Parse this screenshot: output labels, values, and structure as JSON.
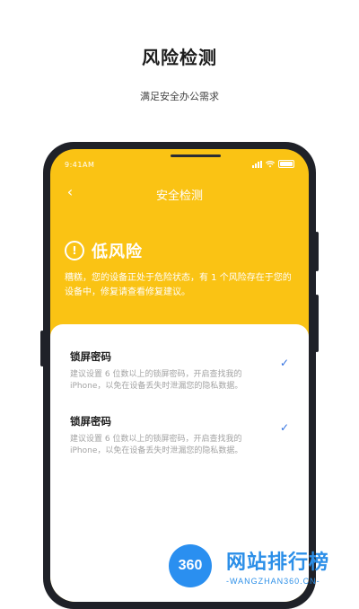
{
  "page": {
    "title": "风险检测",
    "subtitle": "满足安全办公需求"
  },
  "status_bar": {
    "time": "9:41AM"
  },
  "nav": {
    "title": "安全检测"
  },
  "risk": {
    "level": "低风险",
    "description": "糟糕，您的设备正处于危险状态，有 1 个风险存在于您的设备中，修复请查看修复建议。"
  },
  "checks": [
    {
      "title": "锁屏密码",
      "description": "建议设置 6 位数以上的锁屏密码，开启查找我的 iPhone，以免在设备丢失时泄漏您的隐私数据。"
    },
    {
      "title": "锁屏密码",
      "description": "建议设置 6 位数以上的锁屏密码，开启查找我的 iPhone，以免在设备丢失时泄漏您的隐私数据。"
    }
  ],
  "watermark": {
    "badge": "360",
    "name": "网站排行榜",
    "url": "-WANGZHAN360.CN-"
  },
  "colors": {
    "accent": "#fac314",
    "check": "#2f6fe0",
    "watermark": "#2c8fe8"
  },
  "icons": [
    "back-arrow-icon",
    "warning-icon",
    "checkmark-icon",
    "signal-icon",
    "wifi-icon",
    "battery-icon"
  ]
}
